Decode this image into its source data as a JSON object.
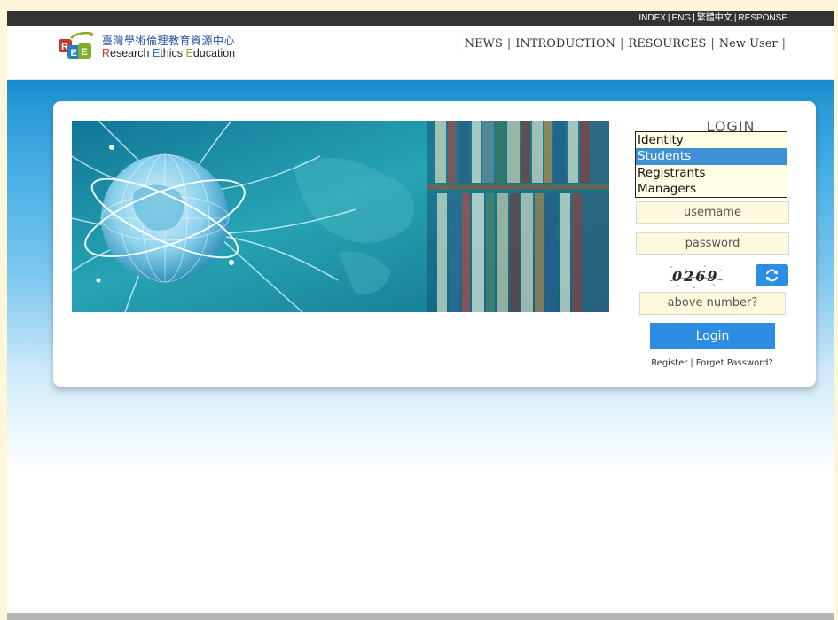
{
  "top_links": [
    "INDEX",
    "ENG",
    "繁體中文",
    "RESPONSE"
  ],
  "logo": {
    "icon": "ree-logo-icon",
    "chinese_name": "臺灣學術倫理教育資源中心",
    "english_name_parts": [
      "R",
      "esearch ",
      "E",
      "thics ",
      "E",
      "ducation"
    ]
  },
  "nav": {
    "items": [
      "NEWS",
      "INTRODUCTION",
      "RESOURCES",
      "New User"
    ]
  },
  "banner": {
    "icon": "globe-bookshelf-banner-image"
  },
  "login": {
    "title": "LOGIN",
    "identity": {
      "options": [
        "Identity",
        "Students",
        "Registrants",
        "Managers"
      ],
      "selected": "Students"
    },
    "username_placeholder": "username",
    "password_placeholder": "password",
    "captcha_text": "0269",
    "refresh_icon": "refresh-icon",
    "captcha_answer_placeholder": "above number?",
    "login_label": "Login",
    "register_label": "Register",
    "forget_label": "Forget Password?"
  },
  "colors": {
    "accent": "#2c8ee2",
    "topbar": "#333333",
    "selected_option": "#3d8fd6",
    "input_bg": "#fdf9dc"
  }
}
